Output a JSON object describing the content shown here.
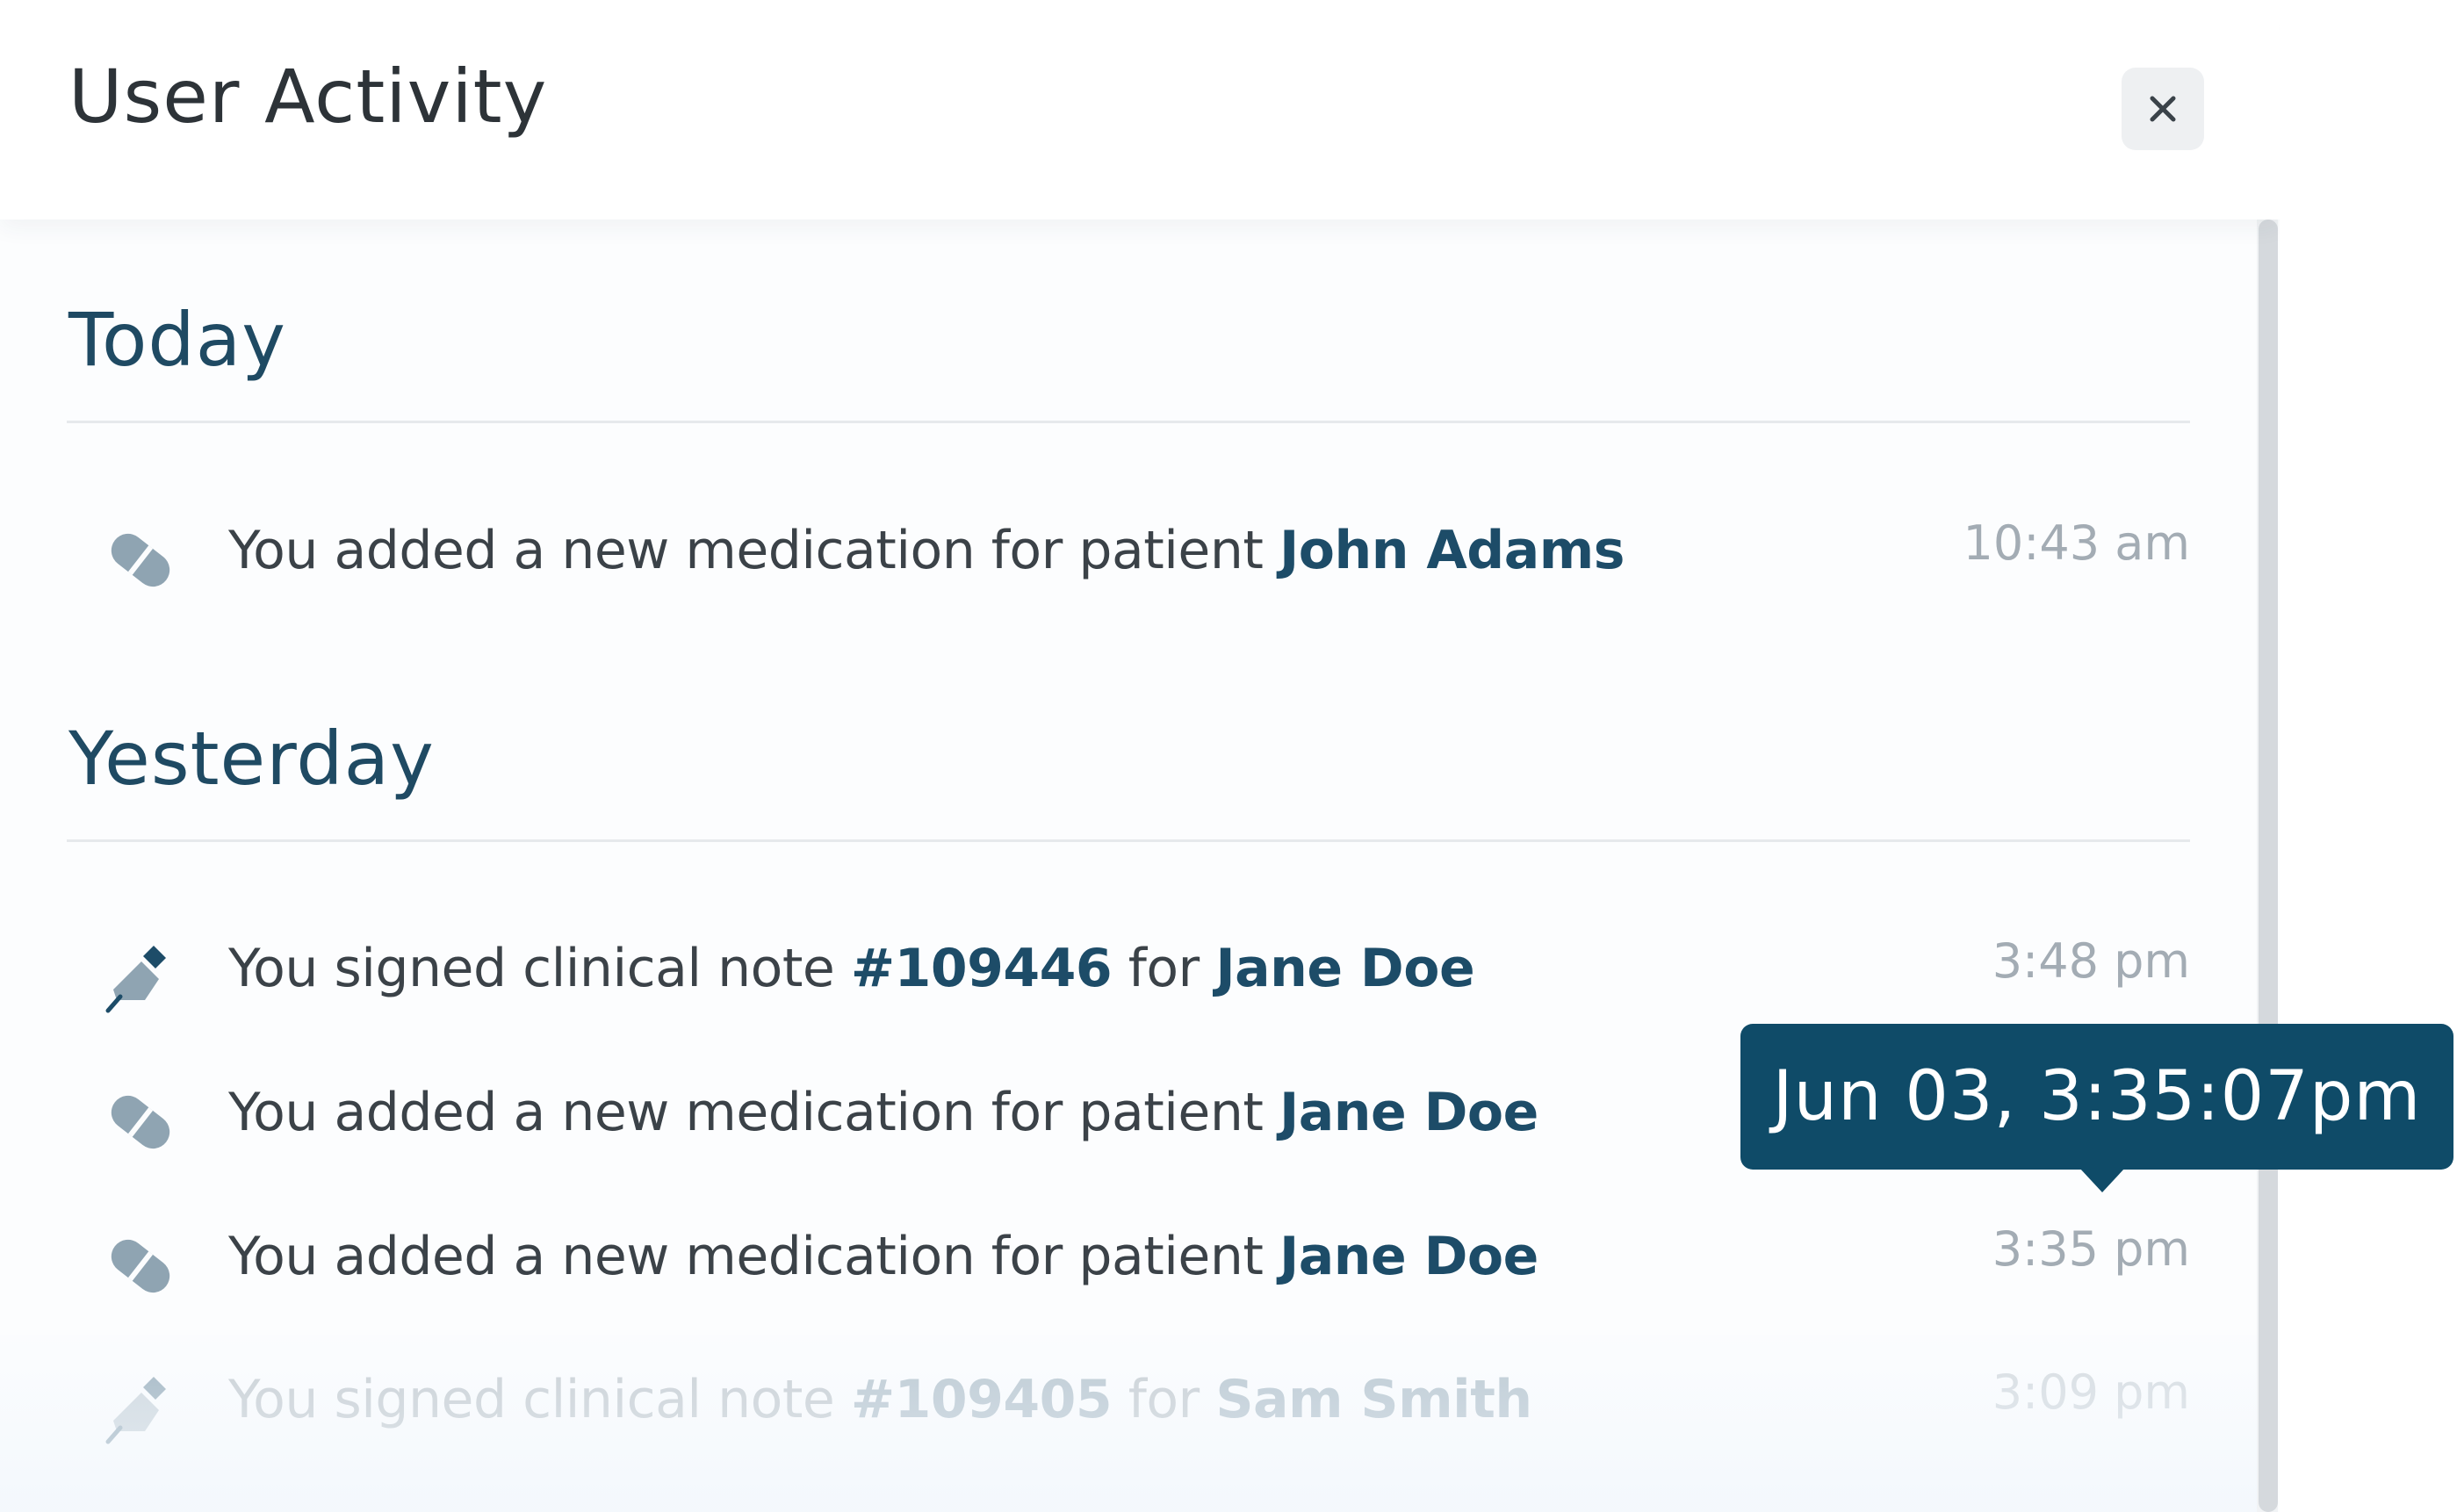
{
  "header": {
    "title": "User Activity",
    "close_icon": "close-icon"
  },
  "sections": [
    {
      "title": "Today",
      "items": [
        {
          "icon": "pill-icon",
          "prefix": "You added a new medication for patient ",
          "patient": "John Adams",
          "time": "10:43 am"
        }
      ]
    },
    {
      "title": "Yesterday",
      "items": [
        {
          "icon": "signature-pen-icon",
          "prefix": "You signed clinical note ",
          "note": "#109446",
          "middle": " for ",
          "patient": "Jane Doe",
          "time": "3:48 pm"
        },
        {
          "icon": "pill-icon",
          "prefix": "You added a new medication for patient ",
          "patient": "Jane Doe",
          "time": ""
        },
        {
          "icon": "pill-icon",
          "prefix": "You added a new medication for patient ",
          "patient": "Jane Doe",
          "time": "3:35 pm"
        },
        {
          "icon": "signature-pen-icon",
          "prefix": "You signed clinical note ",
          "note": "#109405",
          "middle": " for ",
          "patient": "Sam Smith",
          "time": "3:09 pm"
        }
      ]
    }
  ],
  "tooltip": {
    "text": "Jun 03, 3:35:07pm"
  },
  "colors": {
    "accent": "#1d4c68",
    "tooltip_bg": "#0f4b68",
    "icon": "#8ea3b1"
  }
}
